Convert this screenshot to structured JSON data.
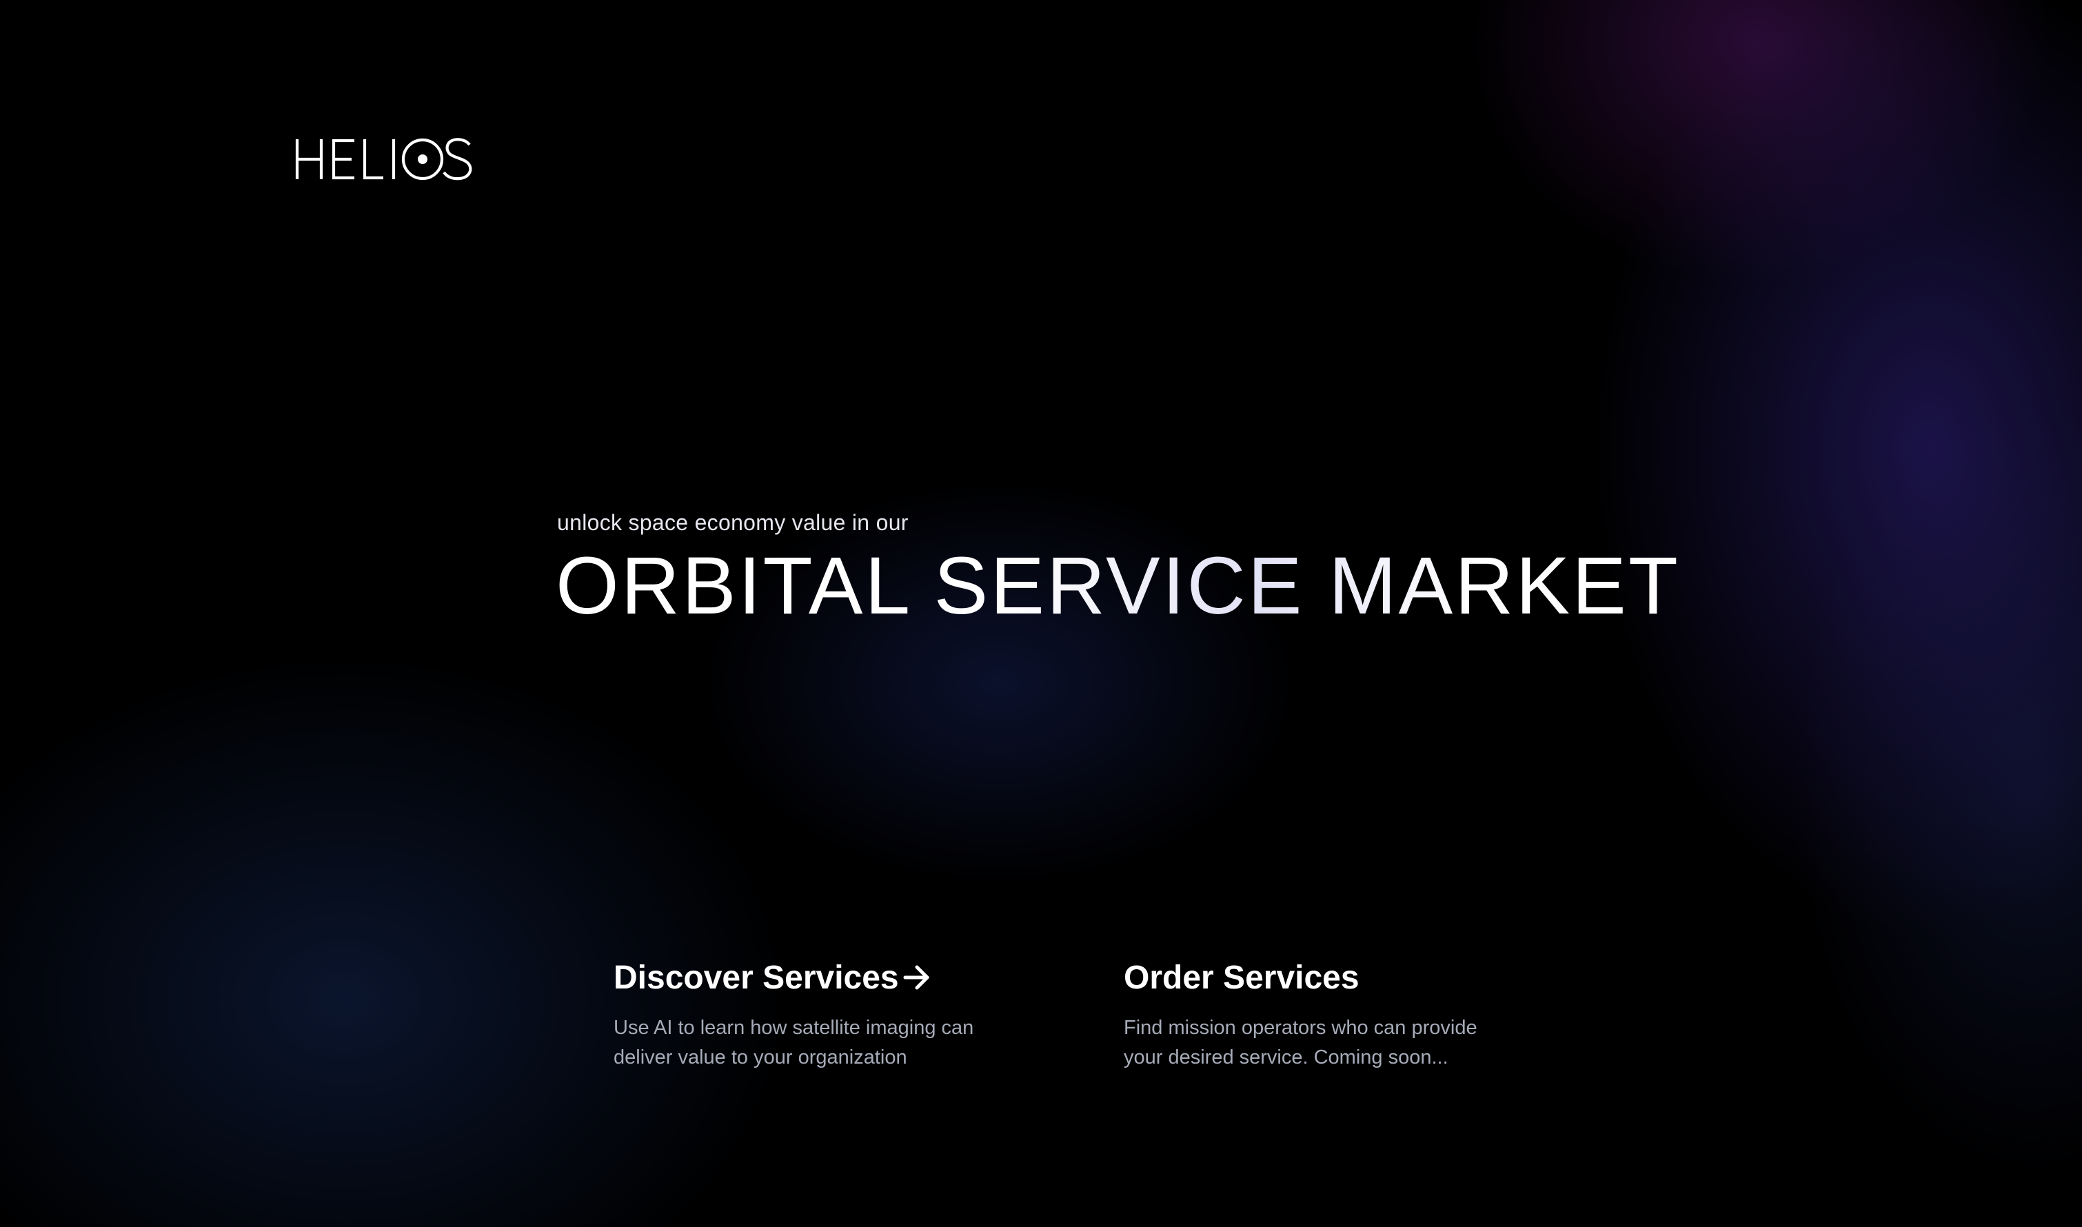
{
  "brand": {
    "logo_text": "HELIOS"
  },
  "hero": {
    "subtitle": "unlock space economy value in our",
    "headline": "ORBITAL SERVICE MARKET"
  },
  "cards": [
    {
      "title": "Discover Services",
      "icon": "arrow-right-icon",
      "description_line1": "Use AI to learn how satellite imaging can",
      "description_line2": "deliver value to your organization"
    },
    {
      "title": "Order Services",
      "description_line1": "Find mission operators who can provide",
      "description_line2": "your desired service. Coming soon..."
    }
  ],
  "colors": {
    "background": "#000000",
    "text_primary": "#ffffff",
    "text_secondary": "#a6abb8",
    "glow_purple": "#231a5f",
    "glow_navy": "#0c1834"
  }
}
